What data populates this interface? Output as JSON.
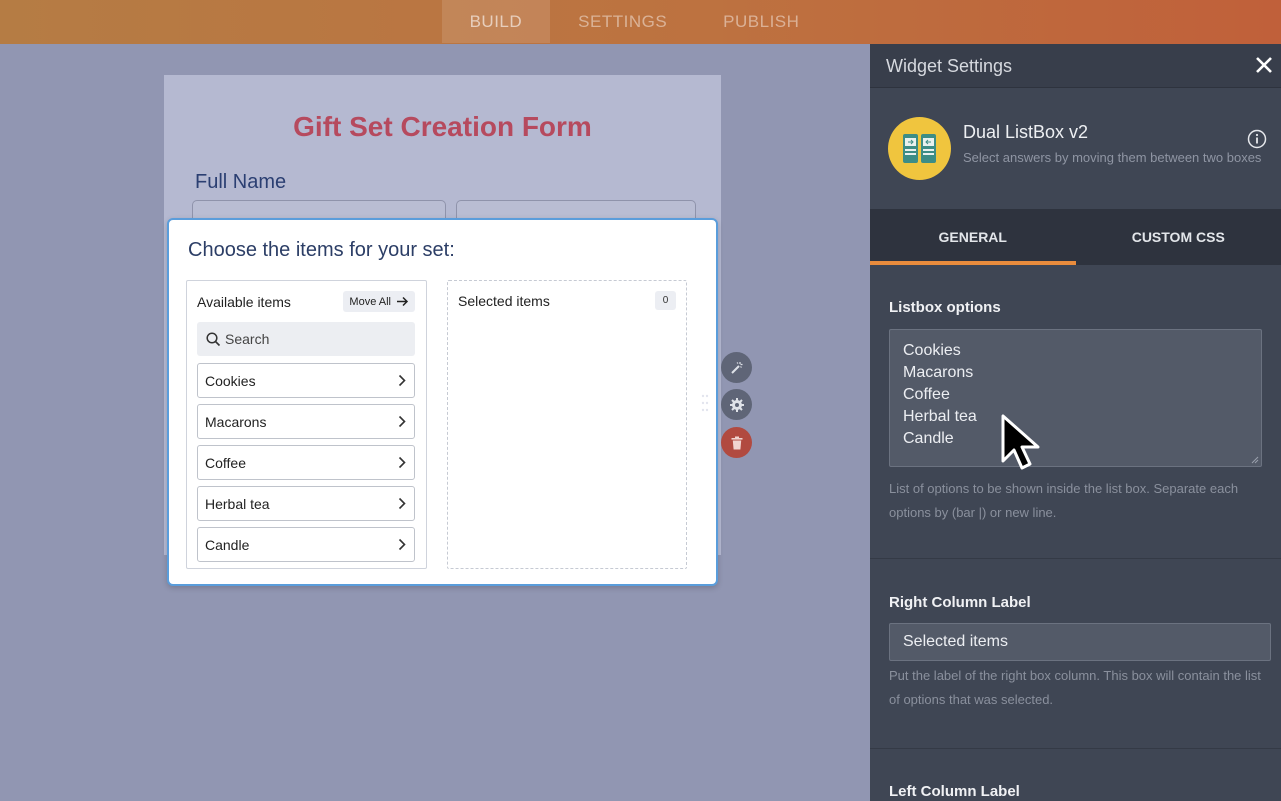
{
  "topbar": {
    "tabs": [
      {
        "label": "BUILD",
        "active": true
      },
      {
        "label": "SETTINGS",
        "active": false
      },
      {
        "label": "PUBLISH",
        "active": false
      }
    ]
  },
  "form": {
    "title": "Gift Set Creation Form",
    "full_name_label": "Full Name"
  },
  "widget": {
    "question": "Choose the items for your set:",
    "left_label": "Available items",
    "move_all": "Move All",
    "search_placeholder": "Search",
    "items": [
      "Cookies",
      "Macarons",
      "Coffee",
      "Herbal tea",
      "Candle"
    ],
    "right_label": "Selected items",
    "selected_count": "0"
  },
  "panel": {
    "title": "Widget Settings",
    "widget_name": "Dual ListBox v2",
    "widget_desc": "Select answers by moving them between two boxes",
    "tabs": [
      {
        "label": "GENERAL",
        "active": true
      },
      {
        "label": "CUSTOM CSS",
        "active": false
      }
    ],
    "listbox_options": {
      "label": "Listbox options",
      "lines": [
        "Cookies",
        "Macarons",
        "Coffee",
        "Herbal tea",
        "Candle"
      ],
      "help": "List of options to be shown inside the list box. Separate each options by (bar |) or new line."
    },
    "right_column": {
      "label": "Right Column Label",
      "value": "Selected items",
      "help": "Put the label of the right box column. This box will contain the list of options that was selected."
    },
    "left_column": {
      "label": "Left Column Label"
    }
  },
  "colors": {
    "accent": "#e98c3d",
    "form_title": "#b64a5e",
    "widget_border": "#5a9ddb",
    "delete": "#b14a40"
  },
  "icons": [
    "search-icon",
    "arrow-right-icon",
    "chevron-right-icon",
    "wand-icon",
    "gear-icon",
    "trash-icon",
    "close-icon",
    "info-icon",
    "dual-listbox-icon",
    "drag-handle-icon",
    "mouse-cursor-icon"
  ]
}
